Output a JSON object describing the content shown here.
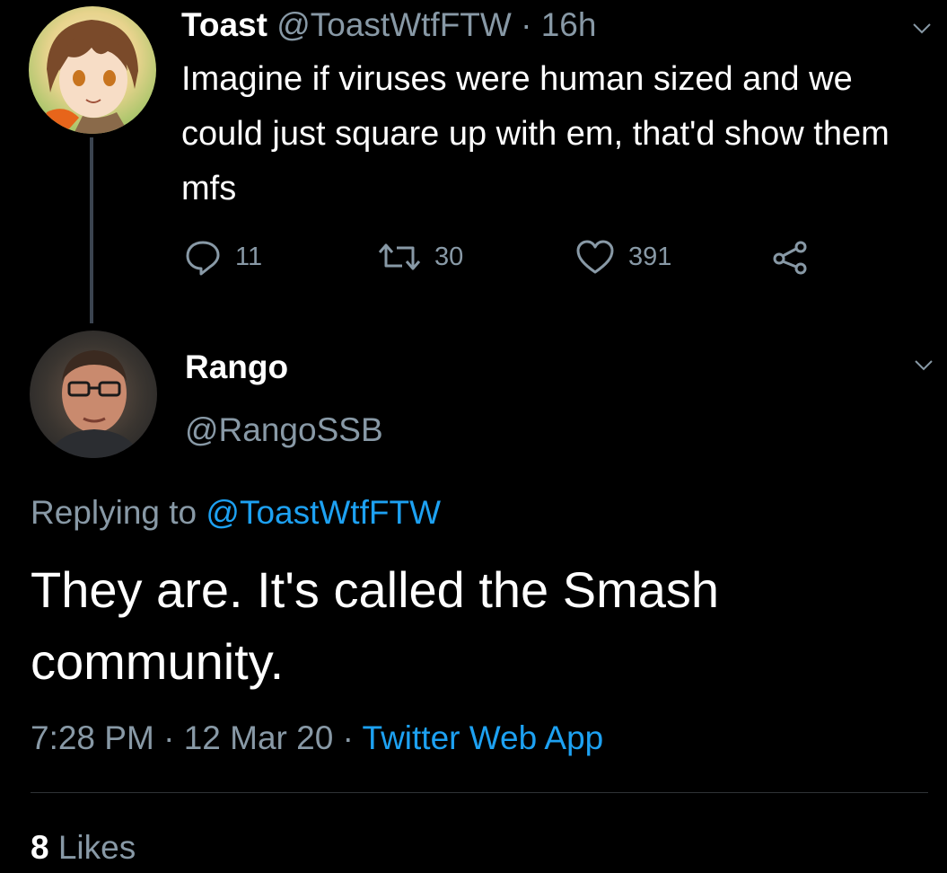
{
  "parent_tweet": {
    "display_name": "Toast",
    "handle": "@ToastWtfFTW",
    "separator": "·",
    "age": "16h",
    "text": "Imagine if viruses were human sized and we could just square up with em, that'd show them mfs",
    "actions": {
      "reply": {
        "icon": "reply-icon",
        "count": "11"
      },
      "retweet": {
        "icon": "retweet-icon",
        "count": "30"
      },
      "like": {
        "icon": "heart-icon",
        "count": "391"
      },
      "share": {
        "icon": "share-icon"
      }
    }
  },
  "reply_tweet": {
    "display_name": "Rango",
    "handle": "@RangoSSB",
    "replying_prefix": "Replying to",
    "replying_to": "@ToastWtfFTW",
    "text": "They are. It's called the Smash community.",
    "time": "7:28 PM",
    "date": "12 Mar 20",
    "source": "Twitter Web App",
    "separator": "·",
    "likes_count": "8",
    "likes_label": "Likes"
  },
  "colors": {
    "background": "#000000",
    "primary_text": "#ffffff",
    "secondary_text": "#8899a6",
    "link": "#1da1f2",
    "divider": "#2f3336"
  }
}
